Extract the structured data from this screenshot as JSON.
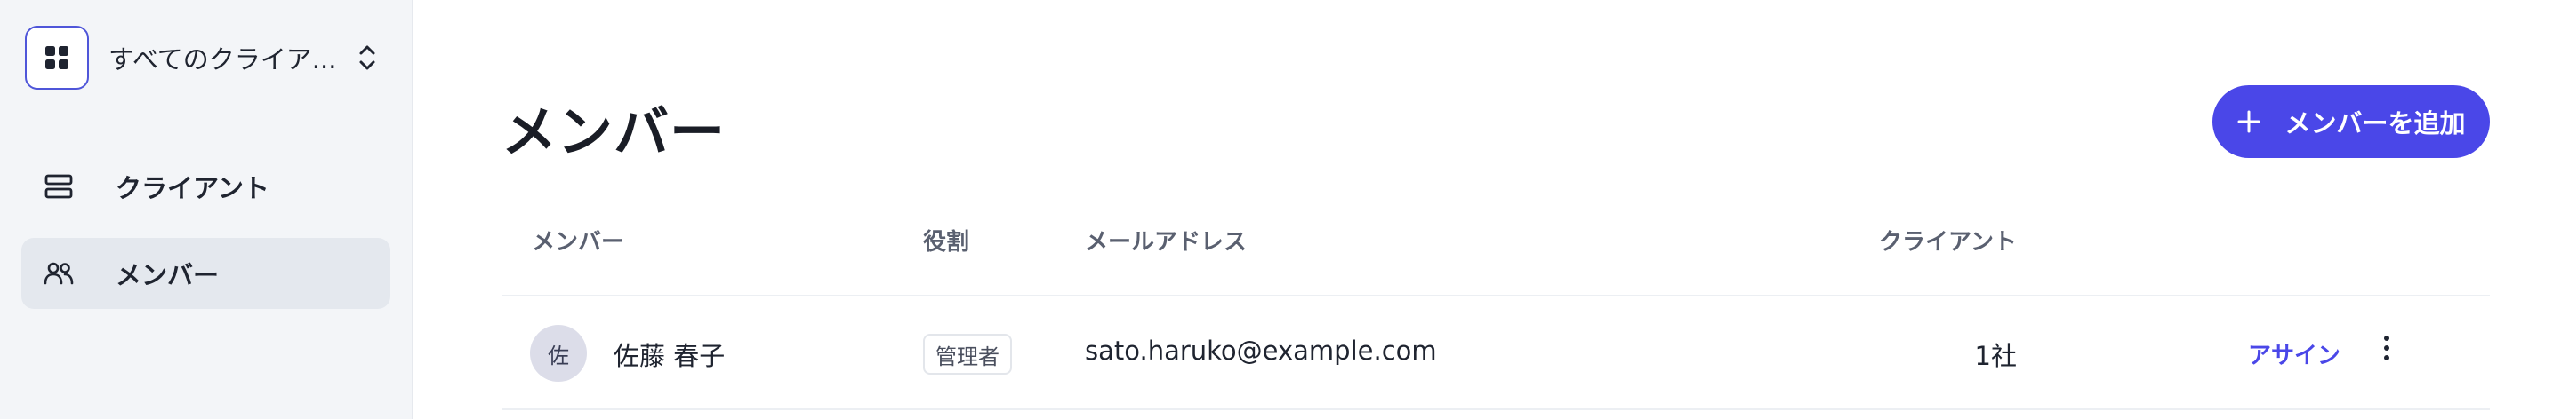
{
  "sidebar": {
    "workspace": {
      "label": "すべてのクライア...",
      "icon": "grid-icon",
      "toggle_icon": "chevron-up-down-icon"
    },
    "items": [
      {
        "label": "クライアント",
        "icon": "server-stack-icon",
        "active": false
      },
      {
        "label": "メンバー",
        "icon": "users-icon",
        "active": true
      }
    ]
  },
  "page": {
    "title": "メンバー",
    "add_button": {
      "label": "メンバーを追加",
      "icon": "plus-icon"
    }
  },
  "table": {
    "columns": {
      "member": "メンバー",
      "role": "役割",
      "email": "メールアドレス",
      "clients": "クライアント"
    },
    "rows": [
      {
        "avatar": "佐",
        "name": "佐藤 春子",
        "role": "管理者",
        "email": "sato.haruko@example.com",
        "clients": "1社",
        "assign_label": "アサイン",
        "more_icon": "more-vertical-icon"
      }
    ]
  },
  "colors": {
    "accent": "#4a47e8",
    "sidebar_bg": "#f3f5f8",
    "active_item_bg": "#e4e8ee"
  }
}
